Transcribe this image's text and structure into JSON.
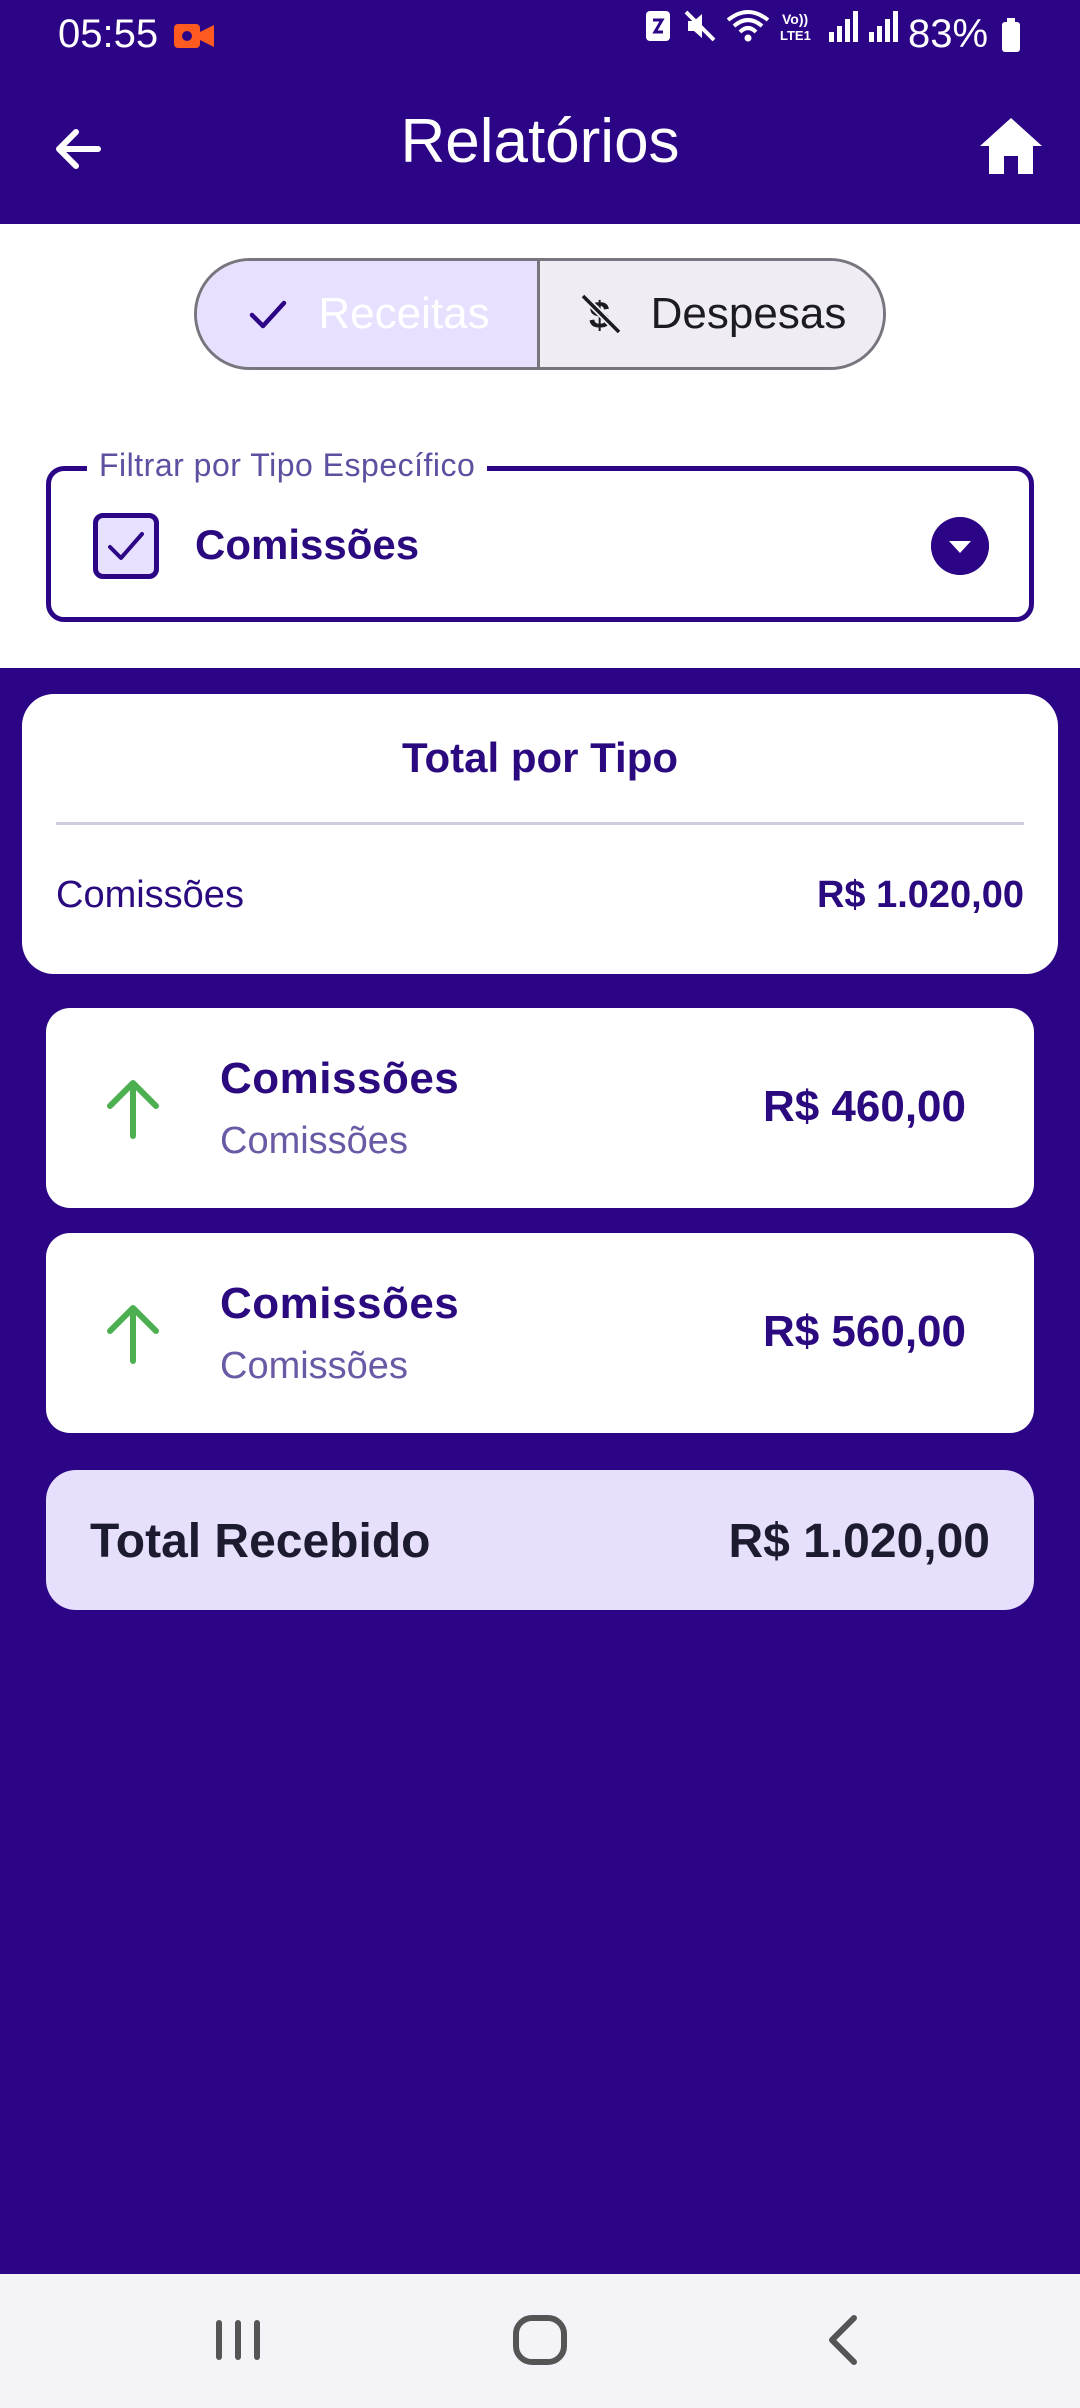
{
  "status_bar": {
    "time": "05:55",
    "battery": "83%",
    "icons": [
      "recording-icon",
      "nfc-icon",
      "mute-icon",
      "wifi-icon",
      "volte-icon",
      "signal-icon",
      "signal-icon",
      "battery-icon"
    ]
  },
  "app_bar": {
    "title": "Relatórios",
    "back_icon": "arrow-left-icon",
    "home_icon": "home-icon"
  },
  "segmented": {
    "options": [
      {
        "label": "Receitas",
        "icon": "check-icon",
        "selected": true
      },
      {
        "label": "Despesas",
        "icon": "money-off-icon",
        "selected": false
      }
    ]
  },
  "filter": {
    "label": "Filtrar por Tipo Específico",
    "value": "Comissões",
    "checked": true
  },
  "total_por_tipo": {
    "title": "Total por Tipo",
    "rows": [
      {
        "label": "Comissões",
        "value": "R$ 1.020,00"
      }
    ]
  },
  "entries": [
    {
      "title": "Comissões",
      "subtitle": "Comissões",
      "value": "R$ 460,00",
      "icon": "arrow-up-icon"
    },
    {
      "title": "Comissões",
      "subtitle": "Comissões",
      "value": "R$ 560,00",
      "icon": "arrow-up-icon"
    }
  ],
  "total": {
    "label": "Total Recebido",
    "value": "R$ 1.020,00"
  },
  "colors": {
    "primary": "#2c0586",
    "accent_light": "#e8e0ff",
    "income_green": "#4caf50"
  }
}
